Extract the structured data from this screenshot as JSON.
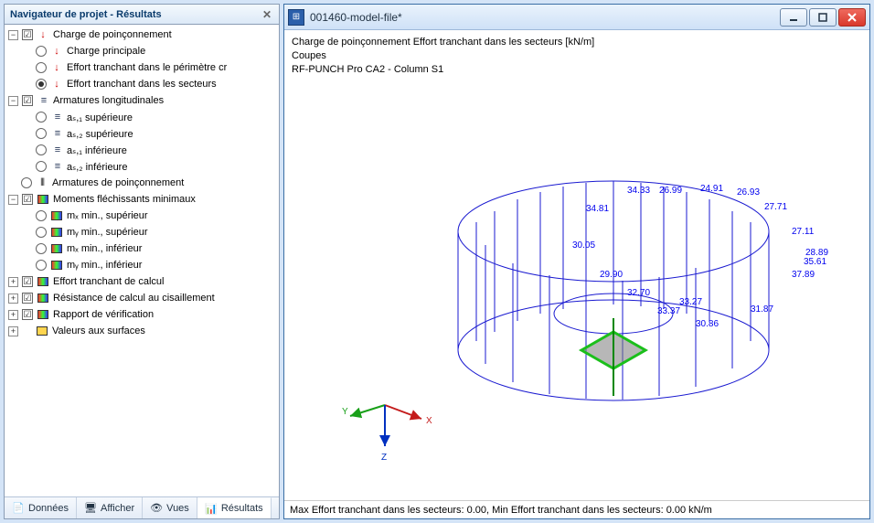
{
  "left": {
    "title": "Navigateur de projet - Résultats",
    "tree": {
      "group1": {
        "label": "Charge de poinçonnement",
        "c1": "Charge principale",
        "c2": "Effort tranchant dans le périmètre cr",
        "c3": "Effort tranchant dans les secteurs"
      },
      "group2": {
        "label": "Armatures longitudinales",
        "c1": "aₛ,₁ supérieure",
        "c2": "aₛ,₂ supérieure",
        "c3": "aₛ,₁ inférieure",
        "c4": "aₛ,₂ inférieure"
      },
      "armpoin": "Armatures de poinçonnement",
      "group3": {
        "label": "Moments fléchissants minimaux",
        "c1": "mₓ min., supérieur",
        "c2": "mᵧ min., supérieur",
        "c3": "mₓ min., inférieur",
        "c4": "mᵧ min., inférieur"
      },
      "eff": "Effort tranchant de calcul",
      "res": "Résistance de calcul au cisaillement",
      "rap": "Rapport de vérification",
      "val": "Valeurs aux surfaces"
    },
    "tabs": {
      "t1": "Données",
      "t2": "Afficher",
      "t3": "Vues",
      "t4": "Résultats"
    }
  },
  "right": {
    "title": "001460-model-file*",
    "header": {
      "l1": "Charge de poinçonnement   Effort tranchant dans les secteurs [kN/m]",
      "l2": "Coupes",
      "l3": "RF-PUNCH Pro CA2 - Column S1"
    },
    "status": "Max Effort tranchant dans les secteurs: 0.00, Min Effort tranchant dans les secteurs: 0.00 kN/m",
    "axes": {
      "x": "X",
      "y": "Y",
      "z": "Z"
    },
    "values": {
      "v1": "34.33",
      "v2": "26.99",
      "v3": "24.91",
      "v4": "26.93",
      "v5": "34.81",
      "v6": "27.71",
      "v7": "27.11",
      "v8": "30.05",
      "v9": "28.89",
      "v10": "35.61",
      "v11": "29.90",
      "v12": "37.89",
      "v13": "32.70",
      "v14": "33.27",
      "v15": "33.37",
      "v16": "31.87",
      "v17": "30.86"
    }
  }
}
